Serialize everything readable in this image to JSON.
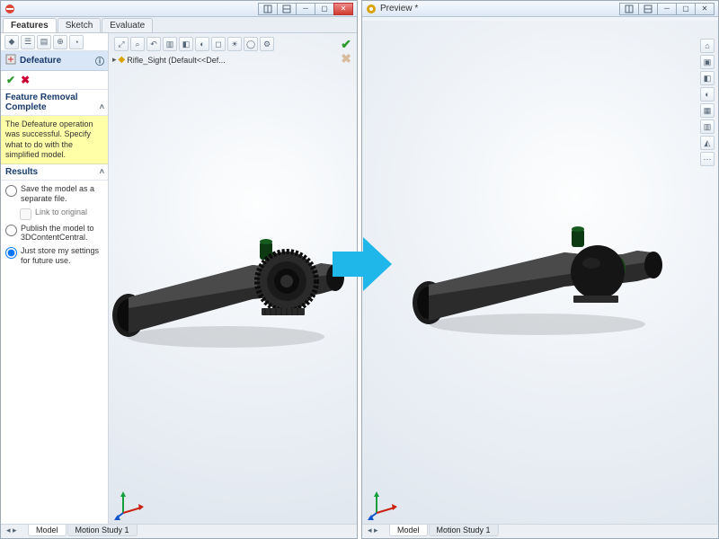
{
  "left": {
    "title": "",
    "top_tabs": [
      "Features",
      "Sketch",
      "Evaluate"
    ],
    "top_tab_active": 0,
    "breadcrumb": "Rifle_Sight  (Default<<Def...",
    "pm": {
      "title": "Defeature",
      "section_fr_complete": "Feature Removal Complete",
      "note": "The Defeature operation was successful. Specify what to do with the simplified model.",
      "section_results": "Results",
      "opt_save": "Save the model as a separate file.",
      "opt_save_link": "Link to original",
      "opt_publish": "Publish the model to 3DContentCentral.",
      "opt_store": "Just store my settings for future use."
    },
    "bottom_tabs": [
      "Model",
      "Motion Study 1"
    ],
    "bottom_active": 0
  },
  "right": {
    "title": "Preview *",
    "bottom_tabs": [
      "Model",
      "Motion Study 1"
    ],
    "bottom_active": 0
  },
  "colors": {
    "arrow": "#1fb6ea"
  }
}
